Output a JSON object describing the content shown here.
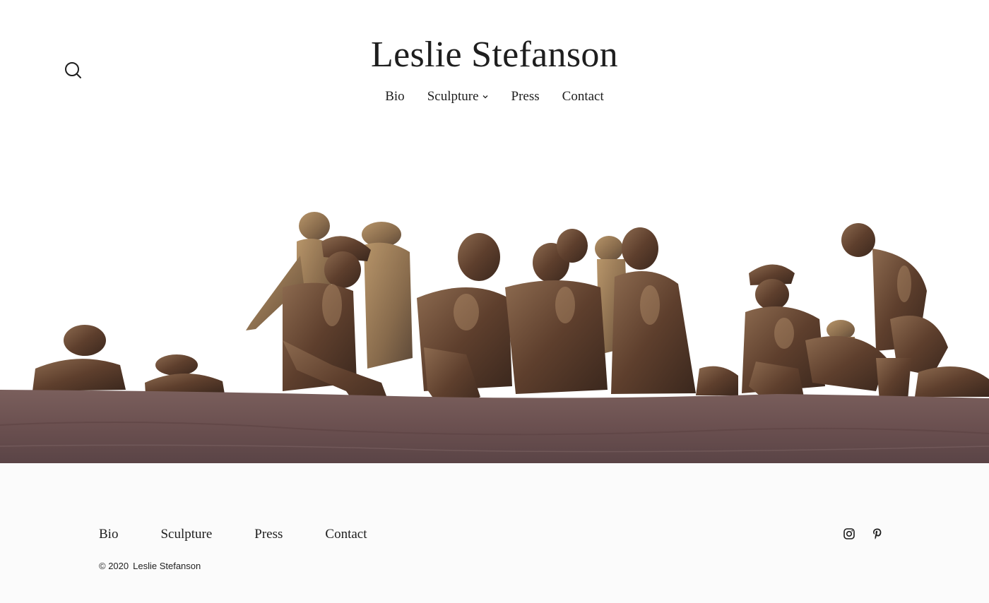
{
  "site": {
    "title": "Leslie Stefanson"
  },
  "nav": {
    "items": [
      {
        "label": "Bio"
      },
      {
        "label": "Sculpture",
        "has_submenu": true
      },
      {
        "label": "Press"
      },
      {
        "label": "Contact"
      }
    ]
  },
  "icons": {
    "search": "search-icon",
    "submenu": "chevron-down-icon",
    "instagram": "instagram-icon",
    "pinterest": "pinterest-icon"
  },
  "footer": {
    "nav": [
      "Bio",
      "Sculpture",
      "Press",
      "Contact"
    ],
    "copyright_symbol": "© 2020",
    "copyright_name": "Leslie Stefanson"
  },
  "colors": {
    "text": "#1e1e1e",
    "bronze": "#6b4a36",
    "base": "#6e5555",
    "footer_bg": "#fbfbfb"
  }
}
